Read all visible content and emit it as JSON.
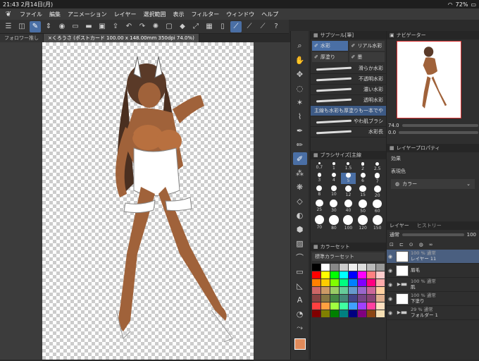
{
  "status": {
    "time": "21:43",
    "date": "2月14日(月)",
    "battery": "72%"
  },
  "menu": [
    "ファイル",
    "編集",
    "アニメーション",
    "レイヤー",
    "選択範囲",
    "表示",
    "フィルター",
    "ウィンドウ",
    "ヘルプ"
  ],
  "tabs": [
    {
      "label": "フォロワー推し"
    },
    {
      "label": "くろうさ (ポストカード 100.00 x 148.00mm 350dpi 74.0%)"
    }
  ],
  "subtool": {
    "title": "サブツール[筆]",
    "tabs": [
      "水彩",
      "リアル水彩",
      "厚塗り",
      "墨"
    ],
    "brushes": [
      "滑らか水彩",
      "不透明水彩",
      "濃い水彩",
      "透明水彩",
      "主線も水彩も厚塗りも一本でや",
      "やわ肌ブラシ",
      "水彩長"
    ]
  },
  "brushsize": {
    "title": "ブラシサイズ[主線",
    "sizes": [
      "0.7",
      "1",
      "1.5",
      "2",
      "2.5",
      "3",
      "4",
      "5",
      "6",
      "7",
      "8",
      "10",
      "12",
      "15",
      "20",
      "25",
      "30",
      "40",
      "50",
      "60",
      "70",
      "80",
      "100",
      "120",
      "150"
    ]
  },
  "colorset": {
    "title": "カラーセット",
    "name": "標準カラーセット",
    "colors": [
      "#000000",
      "#ffffff",
      "#888888",
      "#cccccc",
      "#eeeeee",
      "#dddddd",
      "#bbbbbb",
      "#999999",
      "#ff0000",
      "#ffff00",
      "#00ff00",
      "#00ffff",
      "#0000ff",
      "#ff00ff",
      "#ff8080",
      "#ffcccc",
      "#ff8000",
      "#ffcc00",
      "#80ff00",
      "#00ff80",
      "#0080ff",
      "#8000ff",
      "#ff0080",
      "#ffaaaa",
      "#cc6666",
      "#cc9966",
      "#99cc66",
      "#66cc99",
      "#6699cc",
      "#9966cc",
      "#cc6699",
      "#ffd0a0",
      "#884444",
      "#887744",
      "#448844",
      "#448877",
      "#444488",
      "#774488",
      "#884477",
      "#e0b090",
      "#ff4040",
      "#ffa040",
      "#a0ff40",
      "#40ffa0",
      "#40a0ff",
      "#a040ff",
      "#ff40a0",
      "#ffe0c0",
      "#800000",
      "#808000",
      "#008000",
      "#008080",
      "#000080",
      "#800080",
      "#8b4513",
      "#f5deb3"
    ]
  },
  "navigator": {
    "title": "ナビゲーター",
    "zoom": "74.0",
    "angle": "0.0"
  },
  "property": {
    "title": "レイヤープロパティ",
    "effect": "効果",
    "color_label": "表現色",
    "color_value": "カラー"
  },
  "layers": {
    "title": "レイヤー",
    "tab2": "ヒストリー",
    "blend": "通常",
    "opacity": "100",
    "items": [
      {
        "pct": "100 % 通常",
        "name": "レイヤー 11",
        "type": "layer"
      },
      {
        "pct": "",
        "name": "眉毛",
        "type": "layer"
      },
      {
        "pct": "100 % 通常",
        "name": "肌",
        "type": "folder"
      },
      {
        "pct": "100 % 通常",
        "name": "下塗り",
        "type": "layer"
      },
      {
        "pct": "29 % 通常",
        "name": "フォルダー 1",
        "type": "folder"
      }
    ]
  }
}
